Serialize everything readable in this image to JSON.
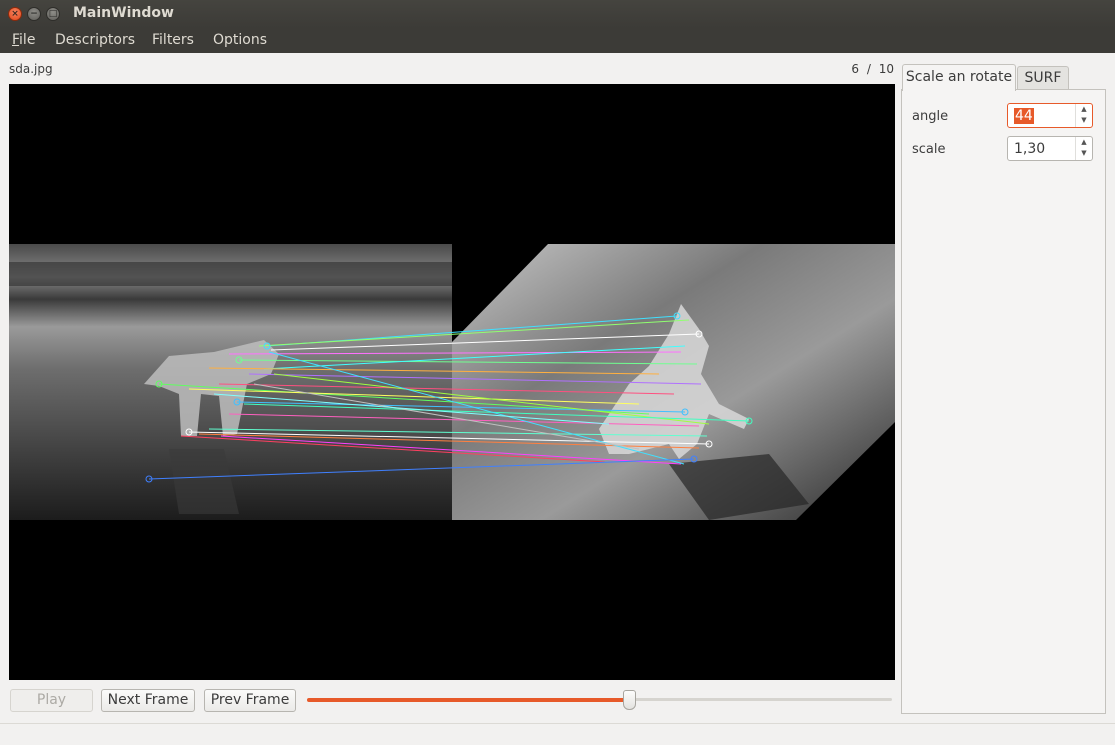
{
  "window": {
    "title": "MainWindow",
    "close_glyph": "×",
    "minimize_glyph": "−",
    "maximize_glyph": "□"
  },
  "menu": {
    "file_mnemonic": "F",
    "file_rest": "ile",
    "descriptors": "Descriptors",
    "filters": "Filters",
    "options": "Options"
  },
  "viewer": {
    "filename": "sda.jpg",
    "frame_current": "6",
    "frame_separator": "/",
    "frame_total": "10"
  },
  "controls": {
    "play_label": "Play",
    "next_label": "Next Frame",
    "prev_label": "Prev Frame",
    "slider_fraction": 0.55
  },
  "panel": {
    "tabs": [
      "Scale an rotate",
      "SURF"
    ],
    "active_tab": 0,
    "fields": [
      {
        "label": "angle",
        "value": "44"
      },
      {
        "label": "scale",
        "value": "1,30"
      }
    ]
  },
  "colors": {
    "accent": "#e75a2a",
    "titlebar": "#3c3b37",
    "viewport_bg": "#000000"
  }
}
